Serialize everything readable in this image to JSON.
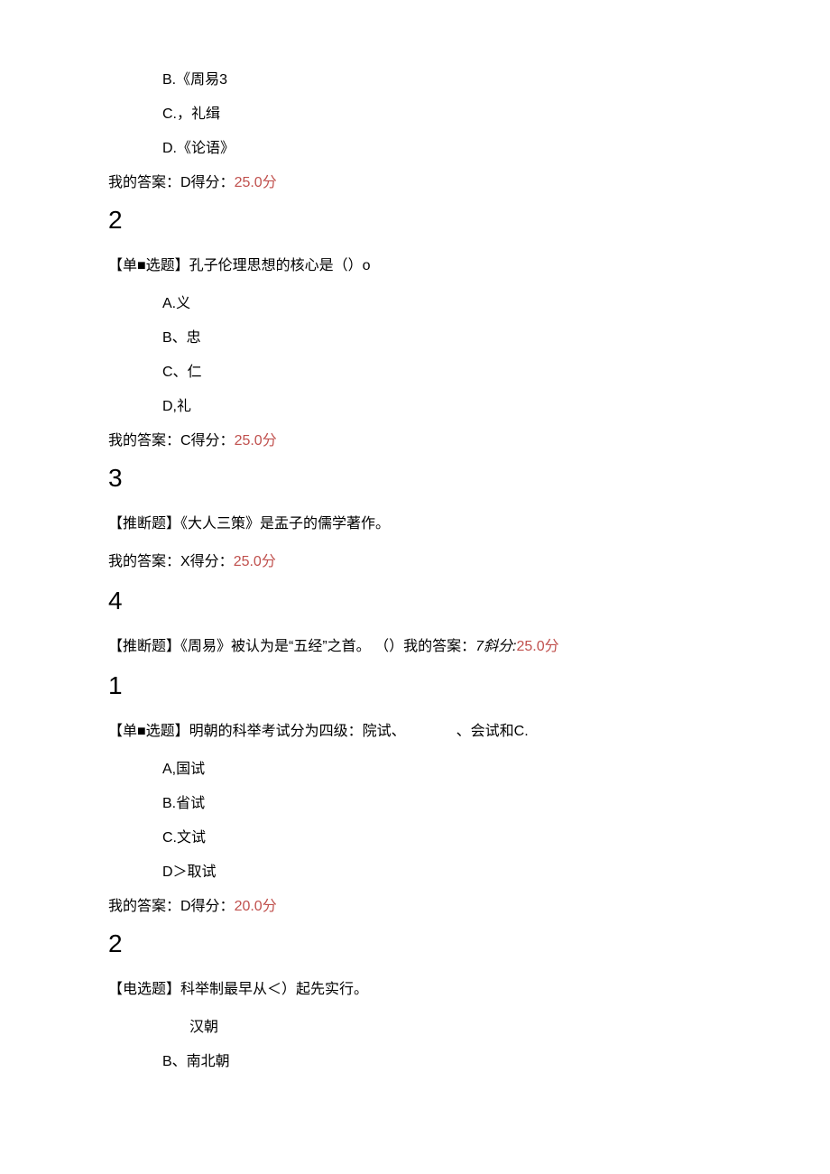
{
  "q1": {
    "optB": "B.《周易3",
    "optC": "C.，礼缉",
    "optD": "D.《论语》",
    "ans_prefix": "我的答案：D得分：",
    "ans_score": "25.0分"
  },
  "num2": "2",
  "q2": {
    "text": "【单■选题】孔子伦理思想的核心是（）o",
    "optA": "A.义",
    "optB": "B、忠",
    "optC": "C、仁",
    "optD": "D,礼",
    "ans_prefix": "我的答案：C得分：",
    "ans_score": "25.0分"
  },
  "num3": "3",
  "q3": {
    "text": "【推断题】《大人三策》是盂子的儒学著作。",
    "ans_prefix": "我的答案：X得分：",
    "ans_score": "25.0分"
  },
  "num4": "4",
  "q4": {
    "text_a": "【推断题】《周易》被认为是“五经”之首。 （）我的答案：",
    "text_b": "7斜分:",
    "text_c": "25.0分"
  },
  "num1b": "1",
  "q5": {
    "text": "【单■选题】明朝的科举考试分为四级：院试、　　　　、会试和C.",
    "optA": "A,国试",
    "optB": "B.省试",
    "optC": "C.文试",
    "optD": "D＞取试",
    "ans_prefix": "我的答案：D得分：",
    "ans_score": "20.0分"
  },
  "num2b": "2",
  "q6": {
    "text": "【电选题】科举制最早从＜）起先实行。",
    "optA": "汉朝",
    "optB": "B、南北朝"
  }
}
